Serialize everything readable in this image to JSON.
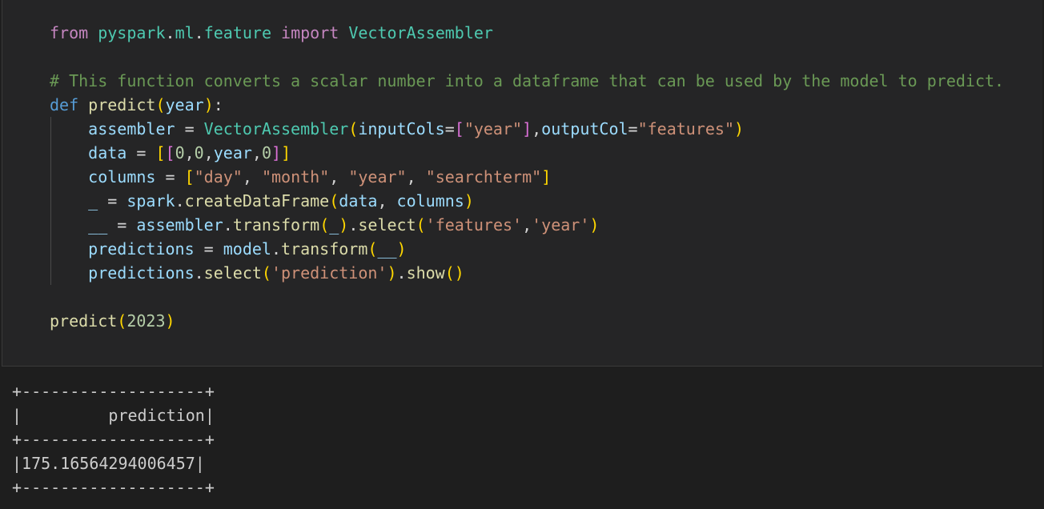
{
  "code_cell": {
    "lines": [
      {
        "tokens": [
          [
            "kw",
            "from"
          ],
          [
            "op",
            " "
          ],
          [
            "mod",
            "pyspark"
          ],
          [
            "op",
            "."
          ],
          [
            "mod",
            "ml"
          ],
          [
            "op",
            "."
          ],
          [
            "mod",
            "feature"
          ],
          [
            "op",
            " "
          ],
          [
            "kw",
            "import"
          ],
          [
            "op",
            " "
          ],
          [
            "cls",
            "VectorAssembler"
          ]
        ]
      },
      {
        "tokens": []
      },
      {
        "tokens": [
          [
            "cmt",
            "# This function converts a scalar number into a dataframe that can be used by the model to predict."
          ]
        ]
      },
      {
        "tokens": [
          [
            "kwb",
            "def"
          ],
          [
            "op",
            " "
          ],
          [
            "fn",
            "predict"
          ],
          [
            "p1",
            "("
          ],
          [
            "var",
            "year"
          ],
          [
            "p1",
            ")"
          ],
          [
            "op",
            ":"
          ]
        ]
      },
      {
        "tokens": [
          [
            "op",
            "    "
          ],
          [
            "var",
            "assembler"
          ],
          [
            "op",
            " = "
          ],
          [
            "cls",
            "VectorAssembler"
          ],
          [
            "p1",
            "("
          ],
          [
            "var",
            "inputCols"
          ],
          [
            "op",
            "="
          ],
          [
            "p2",
            "["
          ],
          [
            "str",
            "\"year\""
          ],
          [
            "p2",
            "]"
          ],
          [
            "op",
            ","
          ],
          [
            "var",
            "outputCol"
          ],
          [
            "op",
            "="
          ],
          [
            "str",
            "\"features\""
          ],
          [
            "p1",
            ")"
          ]
        ]
      },
      {
        "tokens": [
          [
            "op",
            "    "
          ],
          [
            "var",
            "data"
          ],
          [
            "op",
            " = "
          ],
          [
            "p1",
            "["
          ],
          [
            "p2",
            "["
          ],
          [
            "num",
            "0"
          ],
          [
            "op",
            ","
          ],
          [
            "num",
            "0"
          ],
          [
            "op",
            ","
          ],
          [
            "var",
            "year"
          ],
          [
            "op",
            ","
          ],
          [
            "num",
            "0"
          ],
          [
            "p2",
            "]"
          ],
          [
            "p1",
            "]"
          ]
        ]
      },
      {
        "tokens": [
          [
            "op",
            "    "
          ],
          [
            "var",
            "columns"
          ],
          [
            "op",
            " = "
          ],
          [
            "p1",
            "["
          ],
          [
            "str",
            "\"day\""
          ],
          [
            "op",
            ", "
          ],
          [
            "str",
            "\"month\""
          ],
          [
            "op",
            ", "
          ],
          [
            "str",
            "\"year\""
          ],
          [
            "op",
            ", "
          ],
          [
            "str",
            "\"searchterm\""
          ],
          [
            "p1",
            "]"
          ]
        ]
      },
      {
        "tokens": [
          [
            "op",
            "    "
          ],
          [
            "var",
            "_"
          ],
          [
            "op",
            " = "
          ],
          [
            "var",
            "spark"
          ],
          [
            "op",
            "."
          ],
          [
            "fn",
            "createDataFrame"
          ],
          [
            "p1",
            "("
          ],
          [
            "var",
            "data"
          ],
          [
            "op",
            ", "
          ],
          [
            "var",
            "columns"
          ],
          [
            "p1",
            ")"
          ]
        ]
      },
      {
        "tokens": [
          [
            "op",
            "    "
          ],
          [
            "var",
            "__"
          ],
          [
            "op",
            " = "
          ],
          [
            "var",
            "assembler"
          ],
          [
            "op",
            "."
          ],
          [
            "fn",
            "transform"
          ],
          [
            "p1",
            "("
          ],
          [
            "var",
            "_"
          ],
          [
            "p1",
            ")"
          ],
          [
            "op",
            "."
          ],
          [
            "fn",
            "select"
          ],
          [
            "p1",
            "("
          ],
          [
            "str",
            "'features'"
          ],
          [
            "op",
            ","
          ],
          [
            "str",
            "'year'"
          ],
          [
            "p1",
            ")"
          ]
        ]
      },
      {
        "tokens": [
          [
            "op",
            "    "
          ],
          [
            "var",
            "predictions"
          ],
          [
            "op",
            " = "
          ],
          [
            "var",
            "model"
          ],
          [
            "op",
            "."
          ],
          [
            "fn",
            "transform"
          ],
          [
            "p1",
            "("
          ],
          [
            "var",
            "__"
          ],
          [
            "p1",
            ")"
          ]
        ]
      },
      {
        "tokens": [
          [
            "op",
            "    "
          ],
          [
            "var",
            "predictions"
          ],
          [
            "op",
            "."
          ],
          [
            "fn",
            "select"
          ],
          [
            "p1",
            "("
          ],
          [
            "str",
            "'prediction'"
          ],
          [
            "p1",
            ")"
          ],
          [
            "op",
            "."
          ],
          [
            "fn",
            "show"
          ],
          [
            "p1",
            "()"
          ]
        ]
      },
      {
        "tokens": []
      },
      {
        "tokens": [
          [
            "fn",
            "predict"
          ],
          [
            "p1",
            "("
          ],
          [
            "num",
            "2023"
          ],
          [
            "p1",
            ")"
          ]
        ]
      }
    ]
  },
  "output": {
    "lines": [
      "+-------------------+",
      "|         prediction|",
      "+-------------------+",
      "|175.16564294006457|",
      "+-------------------+"
    ]
  }
}
